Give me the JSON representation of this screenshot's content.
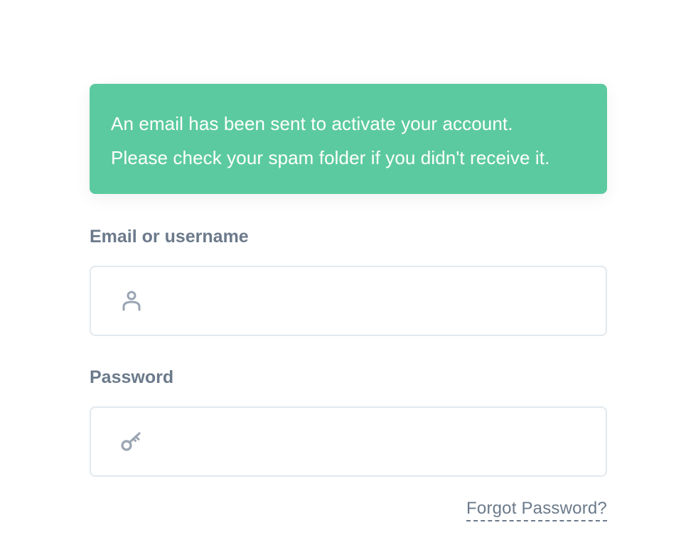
{
  "alert": {
    "line1": "An email has been sent to activate your account.",
    "line2": "Please check your spam folder if you didn't receive it.",
    "color": "#5ccaa0"
  },
  "login": {
    "email_label": "Email or username",
    "email_value": "",
    "email_icon": "user-icon",
    "password_label": "Password",
    "password_value": "",
    "password_icon": "key-icon",
    "forgot_password": "Forgot Password?"
  }
}
